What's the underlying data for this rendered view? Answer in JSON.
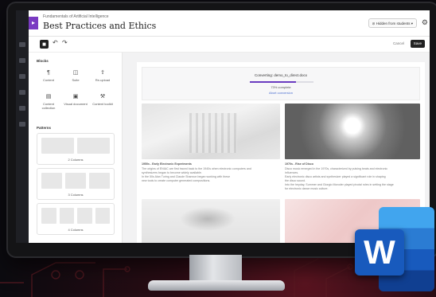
{
  "header": {
    "course_name": "Fundamentals of Artificial Intelligence",
    "page_title": "Best Practices and Ethics",
    "visibility_label": "Hidden from students",
    "brand_badge": "▸"
  },
  "toolbar": {
    "cancel_label": "Cancel",
    "save_label": "Save"
  },
  "panel": {
    "blocks_heading": "Blocks",
    "blocks": [
      {
        "label": "Content",
        "icon": "paragraph-icon"
      },
      {
        "label": "Suite",
        "icon": "suite-icon"
      },
      {
        "label": "Re-upload",
        "icon": "upload-icon"
      },
      {
        "label": "Content collection",
        "icon": "collection-icon"
      },
      {
        "label": "Visual document",
        "icon": "document-icon"
      },
      {
        "label": "Content toolkit",
        "icon": "toolkit-icon"
      }
    ],
    "patterns_heading": "Patterns",
    "layouts": [
      {
        "label": "2 Columns"
      },
      {
        "label": "3 Columns"
      },
      {
        "label": "4 Columns"
      }
    ]
  },
  "conversion": {
    "status": "Converting: demo_to_direct.docx",
    "progress": 0.73,
    "progress_text": "73% complete",
    "abort_label": "Abort conversion"
  },
  "content": {
    "caption_1_title": "1950s - Early Electronic Experiments",
    "caption_1_lines": [
      "The origins of ENIAC are first traced back to the 1940s when electronic computers and",
      "synthesizers began to become widely available.",
      "In the 50s Alan Turing and Claude Shannon began working with these",
      "new tools to create computer generated compositions."
    ],
    "caption_2_title": "1970s - Rise of Disco",
    "caption_2_lines": [
      "Disco music emerged in the 1970s, characterized by pulsing beats and electronic",
      "influences.",
      "Early electronic disco artists and synthesizer played a significant role in shaping",
      "the disco sound.",
      "Into the heyday, Summer and Giorgio Moroder played pivotal roles in setting the stage",
      "for electronic dance music culture."
    ]
  },
  "word_logo_letter": "W",
  "colors": {
    "brand_purple": "#7a3bc2",
    "progress": "#6a3cc0",
    "word_blue": "#185abd"
  }
}
